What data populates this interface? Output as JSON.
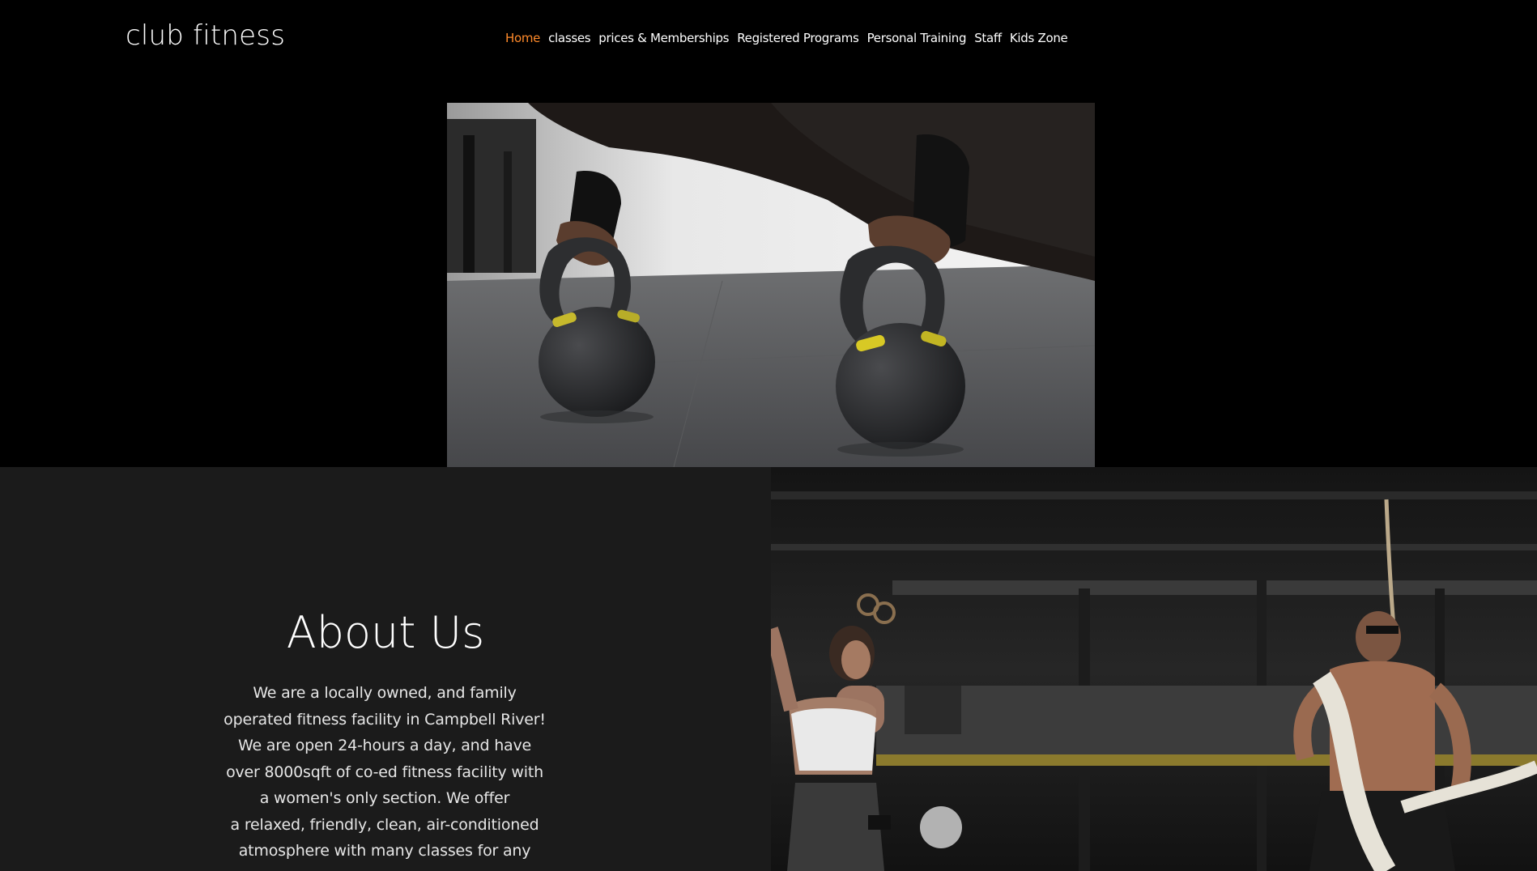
{
  "header": {
    "logo_text": "club fitness",
    "nav": [
      {
        "label": "Home",
        "active": true
      },
      {
        "label": "classes",
        "active": false
      },
      {
        "label": "prices & Memberships",
        "active": false
      },
      {
        "label": "Registered Programs",
        "active": false
      },
      {
        "label": "Personal Training",
        "active": false
      },
      {
        "label": "Staff",
        "active": false
      },
      {
        "label": "Kids Zone",
        "active": false
      }
    ]
  },
  "about": {
    "title": "About Us",
    "lines": [
      "We are a locally owned, and family",
      "operated fitness facility in Campbell River!",
      "We are open 24-hours a day, and have",
      "over 8000sqft of co-ed fitness facility with",
      "a women's only section. We offer",
      "a relaxed, friendly, clean, air-conditioned",
      "atmosphere with many classes for any"
    ]
  },
  "colors": {
    "accent": "#ff8a2a",
    "background": "#000000",
    "about_background": "#1b1b1b"
  }
}
